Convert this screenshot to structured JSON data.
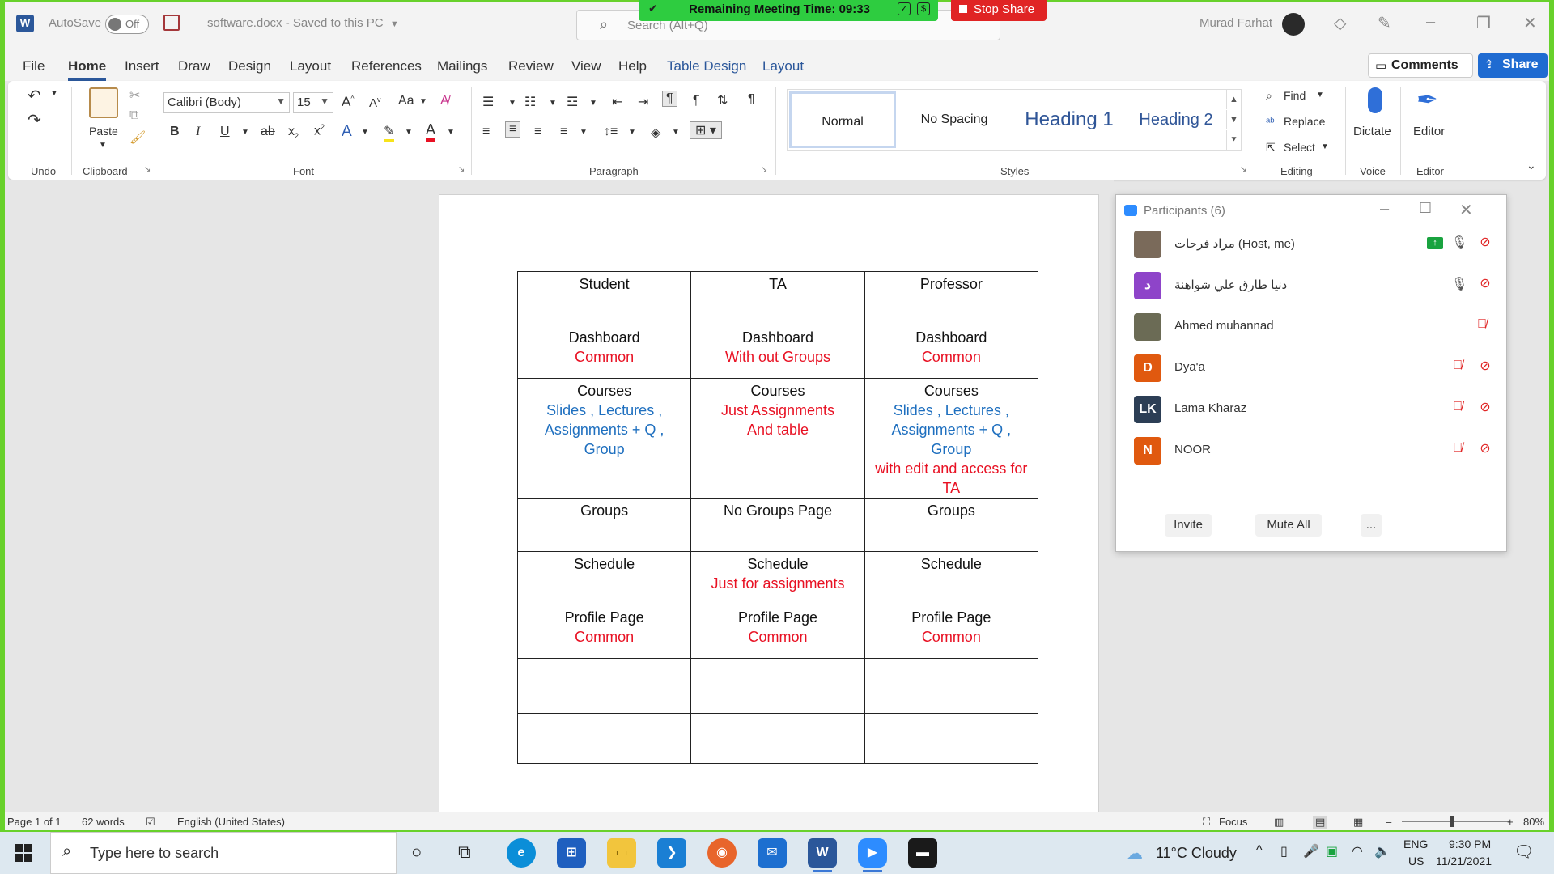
{
  "titlebar": {
    "autosave_label": "AutoSave",
    "autosave_state": "Off",
    "doc_title": "software.docx  -  Saved to this PC",
    "search_placeholder": "Search (Alt+Q)",
    "user_name": "Murad Farhat"
  },
  "meeting": {
    "banner_text": "Remaining Meeting Time: 09:33",
    "dollar_icon": "$",
    "stop_share_label": "Stop Share",
    "banner_color": "#2ecc40",
    "stop_color": "#e02424"
  },
  "tabs": [
    "File",
    "Home",
    "Insert",
    "Draw",
    "Design",
    "Layout",
    "References",
    "Mailings",
    "Review",
    "View",
    "Help",
    "Table Design",
    "Layout"
  ],
  "active_tab": "Home",
  "header_buttons": {
    "comments": "Comments",
    "share": "Share"
  },
  "ribbon": {
    "undo_label": "Undo",
    "clipboard": {
      "label": "Clipboard",
      "paste": "Paste"
    },
    "font": {
      "label": "Font",
      "family": "Calibri (Body)",
      "size": "15",
      "case_btn": "Aa"
    },
    "paragraph": {
      "label": "Paragraph"
    },
    "styles": {
      "label": "Styles",
      "items": [
        "Normal",
        "No Spacing",
        "Heading 1",
        "Heading 2"
      ]
    },
    "editing": {
      "label": "Editing",
      "find": "Find",
      "replace": "Replace",
      "select": "Select"
    },
    "voice": {
      "label": "Voice",
      "dictate": "Dictate"
    },
    "editor": {
      "label": "Editor",
      "editor_btn": "Editor"
    }
  },
  "table": {
    "header": [
      "Student",
      "TA",
      "Professor"
    ],
    "rows": [
      [
        [
          {
            "t": "Dashboard",
            "c": "black"
          },
          {
            "t": "Common",
            "c": "red"
          }
        ],
        [
          {
            "t": "Dashboard",
            "c": "black"
          },
          {
            "t": "With out Groups",
            "c": "red"
          }
        ],
        [
          {
            "t": "Dashboard",
            "c": "black"
          },
          {
            "t": "Common",
            "c": "red"
          }
        ]
      ],
      [
        [
          {
            "t": "Courses",
            "c": "black"
          },
          {
            "t": "Slides , Lectures ,",
            "c": "blue"
          },
          {
            "t": "Assignments + Q ,",
            "c": "blue"
          },
          {
            "t": "Group",
            "c": "blue"
          }
        ],
        [
          {
            "t": "Courses",
            "c": "black"
          },
          {
            "t": "Just Assignments",
            "c": "red"
          },
          {
            "t": "And table",
            "c": "red"
          }
        ],
        [
          {
            "t": "Courses",
            "c": "black"
          },
          {
            "t": "Slides , Lectures ,",
            "c": "blue"
          },
          {
            "t": "Assignments + Q ,",
            "c": "blue"
          },
          {
            "t": "Group",
            "c": "blue"
          },
          {
            "t": "with edit and access for",
            "c": "red"
          },
          {
            "t": "TA",
            "c": "red"
          }
        ]
      ],
      [
        [
          {
            "t": "Groups",
            "c": "black"
          }
        ],
        [
          {
            "t": "No Groups Page",
            "c": "black"
          }
        ],
        [
          {
            "t": "Groups",
            "c": "black"
          }
        ]
      ],
      [
        [
          {
            "t": "Schedule",
            "c": "black"
          }
        ],
        [
          {
            "t": "Schedule",
            "c": "black"
          },
          {
            "t": "Just for assignments",
            "c": "red"
          }
        ],
        [
          {
            "t": "Schedule",
            "c": "black"
          }
        ]
      ],
      [
        [
          {
            "t": "Profile Page",
            "c": "black"
          },
          {
            "t": "Common",
            "c": "red"
          }
        ],
        [
          {
            "t": "Profile Page",
            "c": "black"
          },
          {
            "t": "Common",
            "c": "red"
          }
        ],
        [
          {
            "t": "Profile Page",
            "c": "black"
          },
          {
            "t": "Common",
            "c": "red"
          }
        ]
      ],
      [
        [],
        [],
        []
      ],
      [
        [],
        [],
        []
      ]
    ]
  },
  "participants": {
    "title": "Participants (6)",
    "list": [
      {
        "name": "مراد فرحات (Host, me)",
        "initial": "",
        "color": "#7a6a5a",
        "mic": "on",
        "sharing": true
      },
      {
        "name": "دنيا طارق علي شواهنة",
        "initial": "د",
        "color": "#8e44c9",
        "mic": "on",
        "sharing": false
      },
      {
        "name": "Ahmed muhannad",
        "initial": "",
        "color": "#6b6b55",
        "mic": "muted",
        "sharing": false
      },
      {
        "name": "Dya'a",
        "initial": "D",
        "color": "#e0590f",
        "mic": "muted",
        "sharing": false
      },
      {
        "name": "Lama Kharaz",
        "initial": "LK",
        "color": "#2c3e55",
        "mic": "muted",
        "sharing": false
      },
      {
        "name": "NOOR",
        "initial": "N",
        "color": "#e0590f",
        "mic": "muted",
        "sharing": false
      }
    ],
    "buttons": {
      "invite": "Invite",
      "mute_all": "Mute All",
      "more": "..."
    }
  },
  "statusbar": {
    "page": "Page 1 of 1",
    "words": "62 words",
    "language": "English (United States)",
    "focus": "Focus",
    "zoom": "80%"
  },
  "taskbar": {
    "search_placeholder": "Type here to search",
    "weather": "11°C  Cloudy",
    "lang_top": "ENG",
    "lang_bottom": "US",
    "time": "9:30 PM",
    "date": "11/21/2021"
  }
}
